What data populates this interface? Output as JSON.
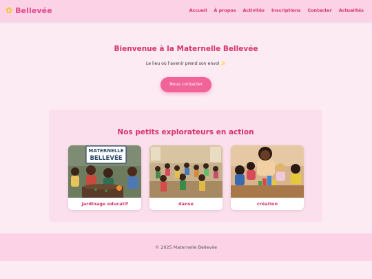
{
  "header": {
    "logo_icon": "flower-icon",
    "logo_text": "Bellevée",
    "nav": [
      "Accueil",
      "À propos",
      "Activités",
      "Inscriptions",
      "Contacter",
      "Actualités"
    ]
  },
  "hero": {
    "title": "Bienvenue à la Maternelle Bellevée",
    "subtitle": "Le lieu où l'avenir prend son envol ✨",
    "cta_label": "Nous contacter"
  },
  "gallery": {
    "title": "Nos petits explorateurs en action",
    "cards": [
      {
        "caption": "Jardinage éducatif",
        "sign_text": [
          "MATERNELLE",
          "BELLEVÉE"
        ]
      },
      {
        "caption": "danse"
      },
      {
        "caption": "création"
      }
    ]
  },
  "footer": {
    "text": "© 2025 Maternelle Bellevée"
  },
  "colors": {
    "primary": "#d6336c",
    "header_bg": "#fcd3e6",
    "page_bg": "#fdebf3",
    "button": "#f06499"
  }
}
